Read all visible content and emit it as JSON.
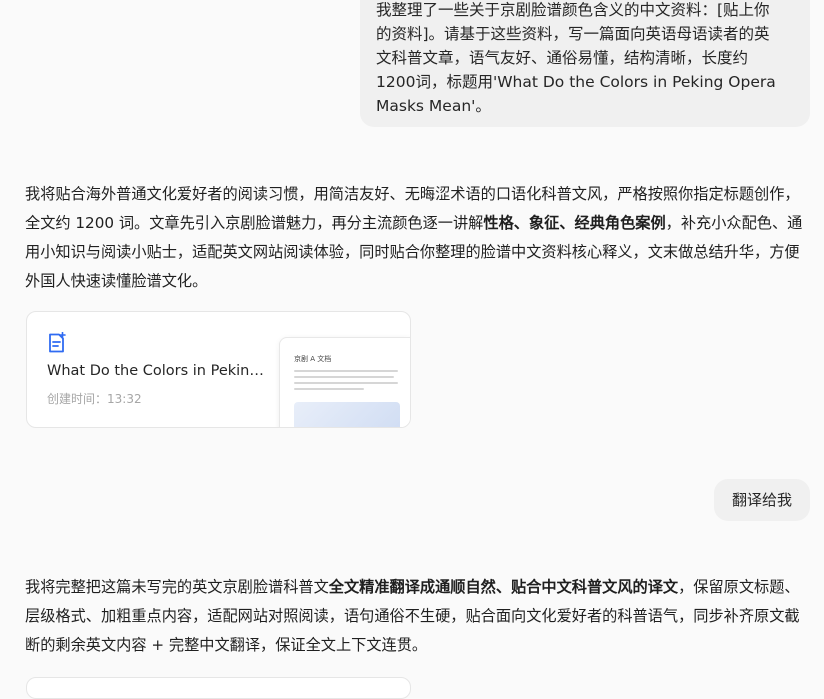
{
  "messages": {
    "user1": {
      "lines": [
        "我整理了一些关于京剧脸谱颜色含义的中文资料：[贴上你",
        "的资料]。请基于这些资料，写一篇面向英语母语读者的英",
        "文科普文章，语气友好、通俗易懂，结构清晰，长度约",
        "1200词，标题用'What Do the Colors in Peking Opera",
        "Masks Mean'。"
      ]
    },
    "assistant1": {
      "text_before": "我将贴合海外普通文化爱好者的阅读习惯，用简洁友好、无晦涩术语的口语化科普文风，严格按照你指定标题创作，全文约 1200 词。文章先引入京剧脸谱魅力，再分主流颜色逐一讲解",
      "text_bold": "性格、象征、经典角色案例",
      "text_after": "，补充小众配色、通用小知识与阅读小贴士，适配英文网站阅读体验，同时贴合你整理的脸谱中文资料核心释义，文末做总结升华，方便外国人快速读懂脸谱文化。"
    },
    "doc_card": {
      "title": "What Do the Colors in Peking...",
      "time_label": "创建时间：13:32",
      "thumb_title": "京剧 A 文档"
    },
    "user2": {
      "text": "翻译给我"
    },
    "assistant2": {
      "text_before": "我将完整把这篇未写完的英文京剧脸谱科普文",
      "text_bold": "全文精准翻译成通顺自然、贴合中文科普文风的译文",
      "text_after": "，保留原文标题、层级格式、加粗重点内容，适配网站对照阅读，语句通俗不生硬，贴合面向文化爱好者的科普语气，同步补齐原文截断的剩余英文内容 + 完整中文翻译，保证全文上下文连贯。"
    }
  },
  "icons": {
    "doc_icon": "document-add-icon"
  },
  "colors": {
    "accent": "#2f6bf2",
    "user_bubble": "#f0f0f0"
  }
}
